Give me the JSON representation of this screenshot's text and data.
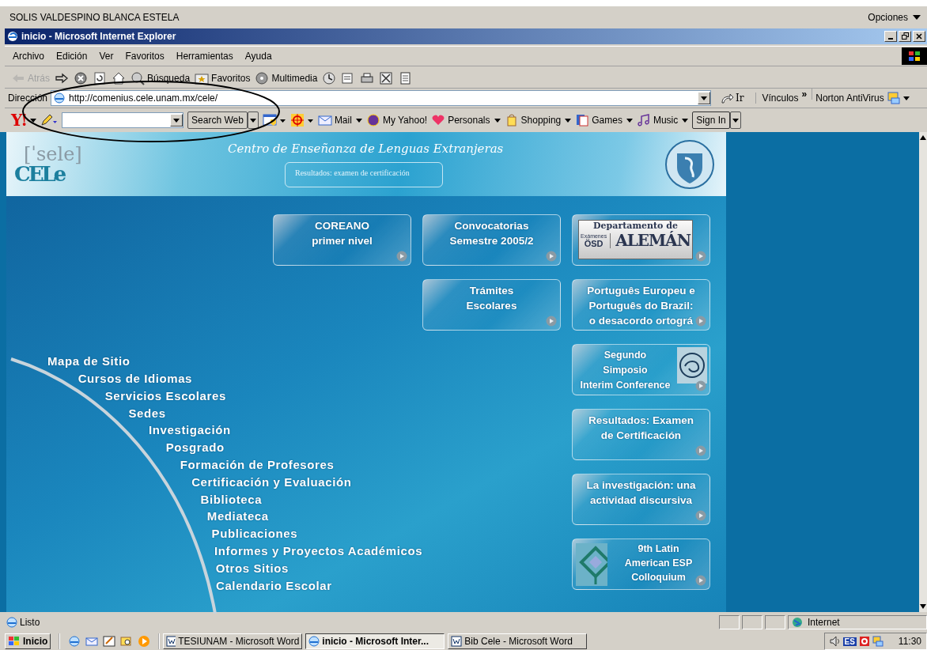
{
  "caption_bar": {
    "user": "SOLIS VALDESPINO BLANCA ESTELA",
    "options": "Opciones"
  },
  "window": {
    "title": "inicio - Microsoft Internet Explorer"
  },
  "menu": [
    "Archivo",
    "Edición",
    "Ver",
    "Favoritos",
    "Herramientas",
    "Ayuda"
  ],
  "toolbar": [
    {
      "kind": "back",
      "label": "Atrás",
      "disabled": true
    },
    {
      "kind": "forward",
      "disabled": false
    },
    {
      "kind": "stop",
      "disabled": false
    },
    {
      "kind": "refresh",
      "disabled": false
    },
    {
      "kind": "home",
      "disabled": false
    },
    {
      "kind": "search",
      "label": "Búsqueda",
      "disabled": false
    },
    {
      "kind": "favorites",
      "label": "Favoritos",
      "disabled": false
    },
    {
      "kind": "media",
      "label": "Multimedia",
      "disabled": false
    },
    {
      "kind": "history",
      "disabled": false
    },
    {
      "kind": "mail",
      "disabled": false
    },
    {
      "kind": "print",
      "disabled": false
    },
    {
      "kind": "edit",
      "disabled": false
    },
    {
      "kind": "discuss",
      "disabled": false
    }
  ],
  "address": {
    "label": "Dirección",
    "url": "http://comenius.cele.unam.mx/cele/",
    "go": "Ir",
    "links": "Vínculos",
    "links_more": "»",
    "norton": "Norton AntiVirus"
  },
  "yahoo_bar": {
    "logo": "Y!",
    "search_button": "Search Web",
    "items": [
      "Mail",
      "My Yahoo!",
      "Personals",
      "Shopping",
      "Games",
      "Music"
    ],
    "sign_in": "Sign In"
  },
  "page": {
    "title": "Centro de Enseñanza de Lenguas Extranjeras",
    "logo_top": "[ˈsele]",
    "logo_bottom": "CELe",
    "banner_box": "Resultados: examen de certificación",
    "tile_columns": [
      [
        {
          "kind": "text",
          "label": "COREANO\nprimer nivel"
        }
      ],
      [
        {
          "kind": "text",
          "label": "Convocatorias\nSemestre 2005/2"
        },
        {
          "kind": "text",
          "label": "Trámites\nEscolares"
        }
      ],
      [
        {
          "kind": "badge",
          "badge_top": "Departamento de",
          "badge_small": "Exámenes",
          "badge_osd": "ÖSD",
          "badge_big": "ALEMÁN"
        },
        {
          "kind": "text",
          "label": "Português Europeu e\nPortuguês do Brazil:\no desacordo ortográ"
        },
        {
          "kind": "emblem",
          "label": "Segundo\nSimposio\nInterim Conference"
        },
        {
          "kind": "text",
          "label": "Resultados: Examen\nde Certificación"
        },
        {
          "kind": "text",
          "label": "La investigación: una\nactividad discursiva"
        },
        {
          "kind": "logo",
          "label": "9th Latin\nAmerican ESP\nColloquium"
        }
      ]
    ],
    "site_map": [
      "Mapa de Sitio",
      "Cursos de Idiomas",
      "Servicios Escolares",
      "Sedes",
      "Investigación",
      "Posgrado",
      "Formación de Profesores",
      "Certificación y Evaluación",
      "Biblioteca",
      "Mediateca",
      "Publicaciones",
      "Informes y Proyectos Académicos",
      "Otros Sitios",
      "Calendario Escolar"
    ]
  },
  "status_bar": {
    "text": "Listo",
    "zone": "Internet"
  },
  "taskbar": {
    "start": "Inicio",
    "tasks": [
      {
        "label": "TESIUNAM - Microsoft Word",
        "kind": "word",
        "selected": false
      },
      {
        "label": "inicio - Microsoft Inter...",
        "kind": "ie",
        "selected": true
      },
      {
        "label": "Bib Cele - Microsoft Word",
        "kind": "word",
        "selected": false
      }
    ],
    "language": "ES",
    "clock": "11:30"
  }
}
